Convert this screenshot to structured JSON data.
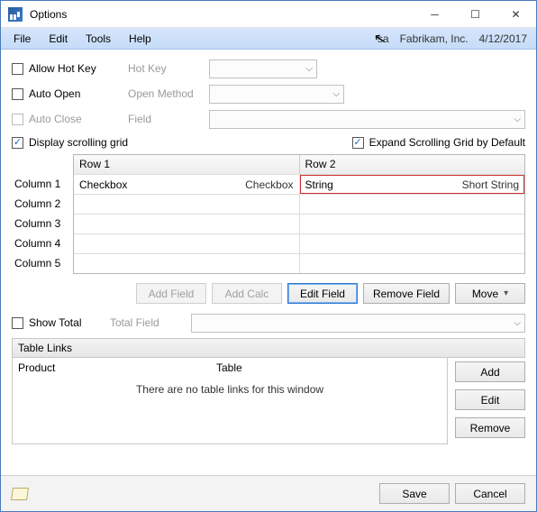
{
  "window": {
    "title": "Options"
  },
  "menu": {
    "file": "File",
    "edit": "Edit",
    "tools": "Tools",
    "help": "Help"
  },
  "status": {
    "user": "sa",
    "company": "Fabrikam, Inc.",
    "date": "4/12/2017"
  },
  "options": {
    "allow_hot_key": {
      "label": "Allow Hot Key",
      "checked": false,
      "field_label": "Hot Key"
    },
    "auto_open": {
      "label": "Auto Open",
      "checked": false,
      "field_label": "Open Method"
    },
    "auto_close": {
      "label": "Auto Close",
      "checked": false,
      "field_label": "Field"
    },
    "display_scrolling": {
      "label": "Display scrolling grid",
      "checked": true
    },
    "expand_scrolling": {
      "label": "Expand Scrolling Grid by Default",
      "checked": true
    },
    "show_total": {
      "label": "Show Total",
      "checked": false,
      "field_label": "Total Field"
    }
  },
  "grid": {
    "headers": {
      "row1": "Row 1",
      "row2": "Row 2"
    },
    "row_labels": [
      "Column 1",
      "Column 2",
      "Column 3",
      "Column 4",
      "Column 5"
    ],
    "cells": {
      "r0c0": {
        "left": "Checkbox",
        "right": "Checkbox"
      },
      "r0c1": {
        "left": "String",
        "right": "Short String"
      }
    }
  },
  "buttons": {
    "add_field": "Add Field",
    "add_calc": "Add Calc",
    "edit_field": "Edit Field",
    "remove_field": "Remove Field",
    "move": "Move",
    "add": "Add",
    "edit": "Edit",
    "remove": "Remove",
    "save": "Save",
    "cancel": "Cancel"
  },
  "links": {
    "section": "Table Links",
    "col_product": "Product",
    "col_table": "Table",
    "empty": "There are no table links for this window"
  }
}
